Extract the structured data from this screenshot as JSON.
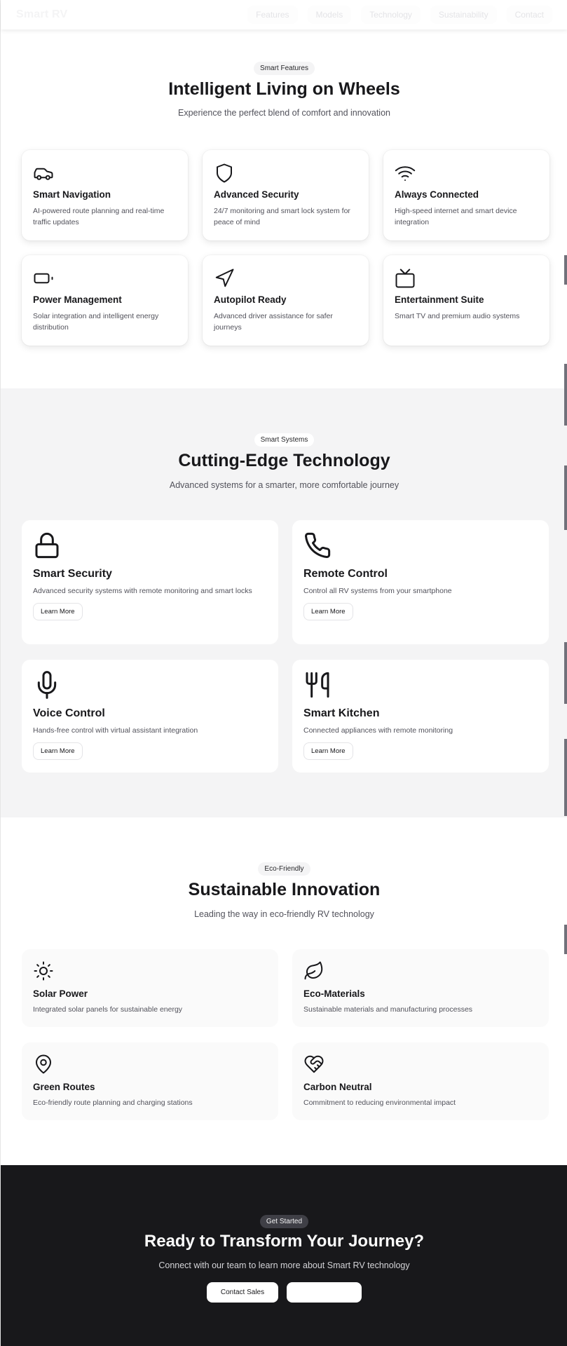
{
  "nav": {
    "brand": "Smart RV",
    "links": [
      "Features",
      "Models",
      "Technology",
      "Sustainability",
      "Contact"
    ]
  },
  "features": {
    "badge": "Smart Features",
    "title": "Intelligent Living on Wheels",
    "subtitle": "Experience the perfect blend of comfort and innovation",
    "items": [
      {
        "icon": "car-icon",
        "title": "Smart Navigation",
        "desc": "AI-powered route planning and real-time traffic updates"
      },
      {
        "icon": "shield-icon",
        "title": "Advanced Security",
        "desc": "24/7 monitoring and smart lock system for peace of mind"
      },
      {
        "icon": "wifi-icon",
        "title": "Always Connected",
        "desc": "High-speed internet and smart device integration"
      },
      {
        "icon": "battery-icon",
        "title": "Power Management",
        "desc": "Solar integration and intelligent energy distribution"
      },
      {
        "icon": "navigation-icon",
        "title": "Autopilot Ready",
        "desc": "Advanced driver assistance for safer journeys"
      },
      {
        "icon": "tv-icon",
        "title": "Entertainment Suite",
        "desc": "Smart TV and premium audio systems"
      }
    ]
  },
  "tech": {
    "badge": "Smart Systems",
    "title": "Cutting-Edge Technology",
    "subtitle": "Advanced systems for a smarter, more comfortable journey",
    "items": [
      {
        "icon": "lock-icon",
        "title": "Smart Security",
        "desc": "Advanced security systems with remote monitoring and smart locks",
        "button": "Learn More"
      },
      {
        "icon": "phone-icon",
        "title": "Remote Control",
        "desc": "Control all RV systems from your smartphone",
        "button": "Learn More"
      },
      {
        "icon": "microphone-icon",
        "title": "Voice Control",
        "desc": "Hands-free control with virtual assistant integration",
        "button": "Learn More"
      },
      {
        "icon": "utensils-icon",
        "title": "Smart Kitchen",
        "desc": "Connected appliances with remote monitoring",
        "button": "Learn More"
      }
    ]
  },
  "eco": {
    "badge": "Eco-Friendly",
    "title": "Sustainable Innovation",
    "subtitle": "Leading the way in eco-friendly RV technology",
    "items": [
      {
        "icon": "sun-icon",
        "title": "Solar Power",
        "desc": "Integrated solar panels for sustainable energy"
      },
      {
        "icon": "leaf-icon",
        "title": "Eco-Materials",
        "desc": "Sustainable materials and manufacturing processes"
      },
      {
        "icon": "map-pin-icon",
        "title": "Green Routes",
        "desc": "Eco-friendly route planning and charging stations"
      },
      {
        "icon": "heart-handshake-icon",
        "title": "Carbon Neutral",
        "desc": "Commitment to reducing environmental impact"
      }
    ]
  },
  "cta": {
    "badge": "Get Started",
    "title": "Ready to Transform Your Journey?",
    "subtitle": "Connect with our team to learn more about Smart RV technology",
    "primary_button": "Contact Sales"
  },
  "colors": {
    "dark": "#18181b",
    "muted": "#52525b",
    "light_section": "#f4f4f5"
  }
}
